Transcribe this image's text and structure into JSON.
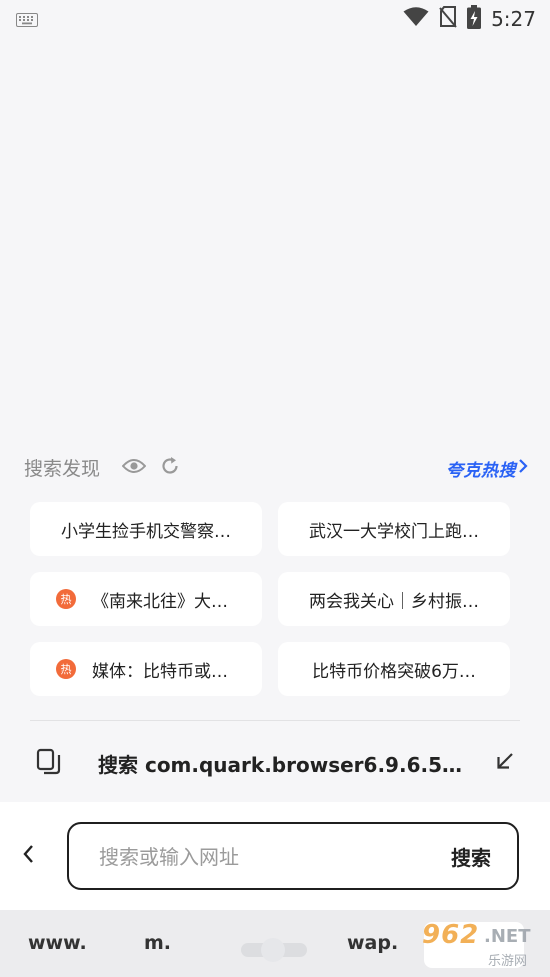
{
  "status_bar": {
    "time": "5:27"
  },
  "discover": {
    "title": "搜索发现",
    "hot_link": "夸克热搜",
    "items": [
      {
        "text": "小学生捡手机交警察…",
        "hot": false
      },
      {
        "text": "武汉一大学校门上跑…",
        "hot": false
      },
      {
        "text": "《南来北往》大…",
        "hot": true
      },
      {
        "text": "两会我关心｜乡村振…",
        "hot": false
      },
      {
        "text": "媒体：比特币或…",
        "hot": true
      },
      {
        "text": "比特币价格突破6万…",
        "hot": false
      }
    ],
    "hot_badge": "热"
  },
  "clipboard": {
    "text": "搜索 com.quark.browser6.9.6.5…"
  },
  "search": {
    "placeholder": "搜索或输入网址",
    "button": "搜索"
  },
  "quick_keys": {
    "k1": "www.",
    "k2": "m.",
    "k3": "wap."
  },
  "watermark": {
    "brand": "962",
    "net": ".NET",
    "sub": "乐游网"
  }
}
